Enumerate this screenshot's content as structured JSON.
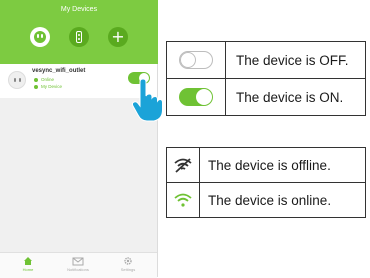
{
  "app": {
    "title": "My Devices",
    "tabs": [
      {
        "icon": "outlet-icon",
        "active": true
      },
      {
        "icon": "remote-icon",
        "active": false
      },
      {
        "icon": "plus-icon",
        "active": false
      }
    ],
    "device": {
      "name": "vesync_wifi_outlet",
      "status_connection": "Online",
      "status_ownership": "My Device",
      "power_on": true
    },
    "footer": [
      {
        "label": "Home",
        "icon": "home-icon",
        "active": true
      },
      {
        "label": "Notifications",
        "icon": "mail-icon",
        "active": false
      },
      {
        "label": "Settings",
        "icon": "gear-icon",
        "active": false
      }
    ]
  },
  "legend_power": [
    {
      "icon": "toggle-off-icon",
      "text": "The device is OFF."
    },
    {
      "icon": "toggle-on-icon",
      "text": "The device is ON."
    }
  ],
  "legend_connection": [
    {
      "icon": "wifi-offline-icon",
      "text": "The device is offline."
    },
    {
      "icon": "wifi-online-icon",
      "text": "The device is online."
    }
  ],
  "colors": {
    "brand_green": "#7dcb41",
    "accent_green": "#6fc234",
    "dark_green": "#5aaa1f",
    "hand_blue": "#1ba3d8",
    "border": "#333333"
  }
}
